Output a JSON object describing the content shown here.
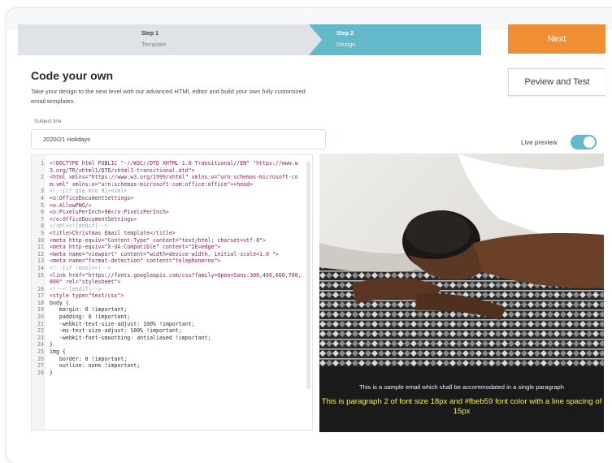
{
  "steps": [
    {
      "title": "Step 1",
      "subtitle": "Template"
    },
    {
      "title": "Step 2",
      "subtitle": "Design"
    }
  ],
  "actions": {
    "next_label": "Next",
    "preview_label": "Peview and Test"
  },
  "page": {
    "title": "Code your own",
    "description": "Take your design to the next level with our advanced HTML editor and build your own fully customized email templates."
  },
  "subject": {
    "label": "Subject line",
    "value": "2020/21 Holidays"
  },
  "live_preview": {
    "label": "Live preview",
    "enabled": true
  },
  "editor": {
    "lines": [
      {
        "n": "1",
        "text": "<!DOCTYPE html PUBLIC \"-//W3C//DTD XHTML 1.0 Transitional//EN\" \"https://www.w3.org/TR/xhtml1/DTD/xhtml1-transitional.dtd\">"
      },
      {
        "n": "2",
        "text": "<html xmlns=\"https://www.w3.org/1999/xhtml\" xmlns:v=\"urn:schemas-microsoft-com:vml\" xmlns:o=\"urn:schemas-microsoft-com:office:office\"><head>"
      },
      {
        "n": "3",
        "text": "<!--[if gte mso 9]><xml>"
      },
      {
        "n": "4",
        "text": "<o:OfficeDocumentSettings>"
      },
      {
        "n": "5",
        "text": "<o:AllowPNG/>"
      },
      {
        "n": "6",
        "text": "<o:PixelsPerInch>96</o:PixelsPerInch>"
      },
      {
        "n": "7",
        "text": "</o:OfficeDocumentSettings>"
      },
      {
        "n": "8",
        "text": "</xml><![endif]-->"
      },
      {
        "n": "9",
        "text": "<title>Christmas Email template</title>"
      },
      {
        "n": "10",
        "text": "<meta http-equiv=\"Content-Type\" content=\"text/html; charset=utf-8\">"
      },
      {
        "n": "11",
        "text": "<meta http-equiv=\"X-UA-Compatible\" content=\"IE=edge\">"
      },
      {
        "n": "12",
        "text": "<meta name=\"viewport\" content=\"width=device-width, initial-scale=1.0 \">"
      },
      {
        "n": "13",
        "text": "<meta name=\"format-detection\" content=\"telephone=no\">"
      },
      {
        "n": "14",
        "text": "<!--[if !mso]><!-->"
      },
      {
        "n": "15",
        "text": "<link href=\"https://fonts.googleapis.com/css?family=Open+Sans:300,400,600,700,800\" rel=\"stylesheet\">"
      },
      {
        "n": "16",
        "text": "<!--<![endif]-->"
      },
      {
        "n": "17",
        "text": "<style type=\"text/css\">"
      },
      {
        "n": "18",
        "text": "body {"
      },
      {
        "n": "19",
        "text": "   margin: 0 !important;"
      },
      {
        "n": "20",
        "text": "   padding: 0 !important;"
      },
      {
        "n": "21",
        "text": "   -webkit-text-size-adjust: 100% !important;"
      },
      {
        "n": "22",
        "text": "   -ms-text-size-adjust: 100% !important;"
      },
      {
        "n": "23",
        "text": "   -webkit-font-smoothing: antialiased !important;"
      },
      {
        "n": "24",
        "text": "}"
      },
      {
        "n": "25",
        "text": "img {"
      },
      {
        "n": "26",
        "text": "   border: 0 !important;"
      },
      {
        "n": "27",
        "text": "   outline: none !important;"
      },
      {
        "n": "28",
        "text": "}"
      }
    ]
  },
  "preview": {
    "caption_line1": "This is a sample email which shall be accommodated in a single paragraph",
    "caption_line2": "This is paragraph 2 of font size 18px and #fbeb59 font color with a line spacing of 15px"
  },
  "colors": {
    "accent": "#63b9c9",
    "next_button": "#ef8e33",
    "caption_highlight": "#fbeb59"
  }
}
